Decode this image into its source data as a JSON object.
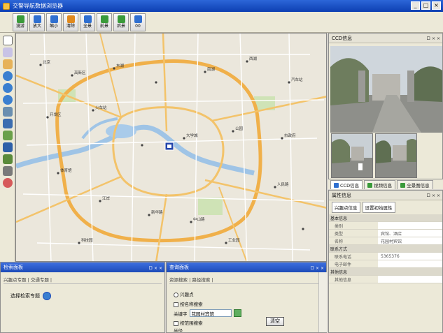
{
  "window": {
    "title": "交警导航数据浏览器",
    "min": "_",
    "max": "□",
    "close": "×"
  },
  "toolbar": {
    "buttons": [
      {
        "label": "漫游",
        "icon": "pan-icon",
        "color": "#3a9a3a"
      },
      {
        "label": "放大",
        "icon": "zoom-in-icon",
        "color": "#2f6fd0"
      },
      {
        "label": "缩小",
        "icon": "zoom-out-icon",
        "color": "#2f6fd0"
      },
      {
        "label": "清除",
        "icon": "clear-icon",
        "color": "#e08a1e"
      },
      {
        "label": "全景",
        "icon": "full-extent-icon",
        "color": "#2f6fd0"
      },
      {
        "label": "前景",
        "icon": "forward-icon",
        "color": "#3a9a3a"
      },
      {
        "label": "后景",
        "icon": "back-icon",
        "color": "#3a9a3a"
      },
      {
        "label": "00",
        "icon": "play-icon",
        "color": "#2f6fd0"
      }
    ]
  },
  "map": {
    "labels": [
      "北京",
      "高新区",
      "东湖",
      "南湖",
      "西湖",
      "开发区",
      "火车站",
      "大学城",
      "公园",
      "市政府",
      "体育馆",
      "江岸",
      "新华路",
      "中山路",
      "人民路",
      "工业园",
      "科技园",
      "汽车站"
    ],
    "marker": "poi-marker"
  },
  "ccd": {
    "title": "CCD信息",
    "controls": "ロ × ×"
  },
  "ccd_tabs": [
    {
      "label": "CCD信息",
      "color": "#2f6fd0"
    },
    {
      "label": "视频信息",
      "color": "#3a9a3a"
    },
    {
      "label": "全景图信息",
      "color": "#3a9a3a"
    }
  ],
  "attributes": {
    "title": "属性信息",
    "controls": "ロ × ×",
    "tabs": [
      "兴趣点信息",
      "设置初始属性"
    ],
    "groups": [
      {
        "name": "基本信息",
        "rows": [
          {
            "k": "类别",
            "v": ""
          },
          {
            "k": "类型",
            "v": "宾馆、酒店"
          },
          {
            "k": "名称",
            "v": "花园村宾馆"
          }
        ]
      },
      {
        "name": "联系方式",
        "rows": [
          {
            "k": "联系电话",
            "v": "5365376"
          },
          {
            "k": "电子邮件",
            "v": ""
          }
        ]
      },
      {
        "name": "其他信息",
        "rows": [
          {
            "k": "其他信息",
            "v": ""
          }
        ]
      }
    ]
  },
  "search": {
    "title": "检索面板",
    "controls": "ロ × ×",
    "sub": "兴趣点专题 | 交通专题 |",
    "label": "选择检索专题"
  },
  "query": {
    "title": "查询面板",
    "controls": "ロ × ×",
    "sub": "资源搜索 | 路径搜索 |",
    "radio_label": "兴趣点",
    "check1": "按名称搜索",
    "keyword_label": "关键字",
    "keyword_value": "花园村宾馆",
    "check2": "按范围搜索",
    "clear_button": "清空",
    "extra_label": "半径"
  }
}
